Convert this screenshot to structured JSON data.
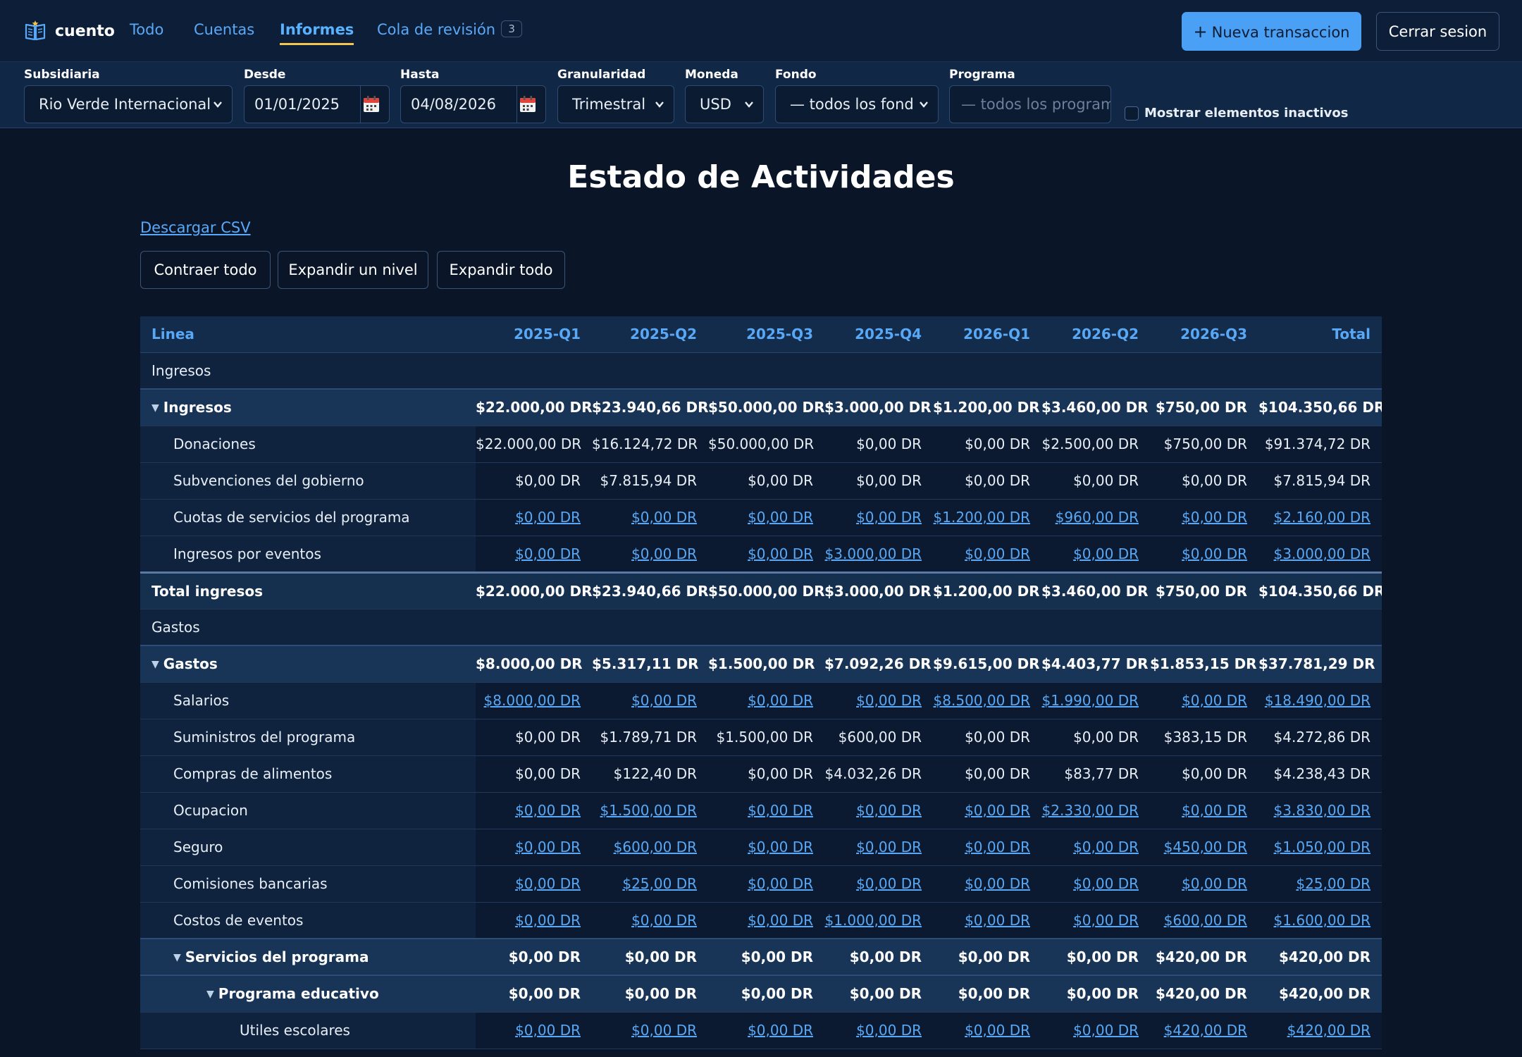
{
  "app": {
    "brand": "cuento",
    "nav": [
      {
        "label": "Todo"
      },
      {
        "label": "Cuentas"
      },
      {
        "label": "Informes",
        "active": true
      },
      {
        "label": "Cola de revisión",
        "badge": "3"
      }
    ],
    "new_tx_label": "Nueva transaccion",
    "logout_label": "Cerrar sesion",
    "accent": "#49a0f5",
    "link_color": "#58a8f6",
    "active_underline": "#f4c64f"
  },
  "filters": {
    "subsidiaria": {
      "label": "Subsidiaria",
      "value": "Rio Verde Internacional"
    },
    "desde": {
      "label": "Desde",
      "value": "01/01/2025"
    },
    "hasta": {
      "label": "Hasta",
      "value": "04/08/2026"
    },
    "granularidad": {
      "label": "Granularidad",
      "value": "Trimestral"
    },
    "moneda": {
      "label": "Moneda",
      "value": "USD"
    },
    "fondo": {
      "label": "Fondo",
      "value": "— todos los fond"
    },
    "programa": {
      "label": "Programa",
      "placeholder": "— todos los program"
    },
    "inactivos": {
      "label": "Mostrar elementos inactivos",
      "checked": false
    }
  },
  "report": {
    "title": "Estado de Actividades",
    "csv_label": "Descargar CSV",
    "collapse_all": "Contraer todo",
    "expand_one": "Expandir un nivel",
    "expand_all": "Expandir todo",
    "columns": [
      "Linea",
      "2025-Q1",
      "2025-Q2",
      "2025-Q3",
      "2025-Q4",
      "2026-Q1",
      "2026-Q2",
      "2026-Q3",
      "Total"
    ],
    "rows": [
      {
        "type": "section",
        "label": "Ingresos"
      },
      {
        "type": "group",
        "label": "Ingresos",
        "indent": 1,
        "values": [
          "$22.000,00 DR",
          "$23.940,66 DR",
          "$50.000,00 DR",
          "$3.000,00 DR",
          "$1.200,00 DR",
          "$3.460,00 DR",
          "$750,00 DR",
          "$104.350,66 DR"
        ]
      },
      {
        "type": "line",
        "label": "Donaciones",
        "indent": 2,
        "link": false,
        "values": [
          "$22.000,00 DR",
          "$16.124,72 DR",
          "$50.000,00 DR",
          "$0,00 DR",
          "$0,00 DR",
          "$2.500,00 DR",
          "$750,00 DR",
          "$91.374,72 DR"
        ]
      },
      {
        "type": "line",
        "label": "Subvenciones del gobierno",
        "indent": 2,
        "link": false,
        "values": [
          "$0,00 DR",
          "$7.815,94 DR",
          "$0,00 DR",
          "$0,00 DR",
          "$0,00 DR",
          "$0,00 DR",
          "$0,00 DR",
          "$7.815,94 DR"
        ]
      },
      {
        "type": "line",
        "label": "Cuotas de servicios del programa",
        "indent": 2,
        "link": true,
        "values": [
          "$0,00 DR",
          "$0,00 DR",
          "$0,00 DR",
          "$0,00 DR",
          "$1.200,00 DR",
          "$960,00 DR",
          "$0,00 DR",
          "$2.160,00 DR"
        ]
      },
      {
        "type": "line",
        "label": "Ingresos por eventos",
        "indent": 2,
        "link": true,
        "values": [
          "$0,00 DR",
          "$0,00 DR",
          "$0,00 DR",
          "$3.000,00 DR",
          "$0,00 DR",
          "$0,00 DR",
          "$0,00 DR",
          "$3.000,00 DR"
        ]
      },
      {
        "type": "total",
        "label": "Total ingresos",
        "values": [
          "$22.000,00 DR",
          "$23.940,66 DR",
          "$50.000,00 DR",
          "$3.000,00 DR",
          "$1.200,00 DR",
          "$3.460,00 DR",
          "$750,00 DR",
          "$104.350,66 DR"
        ]
      },
      {
        "type": "section",
        "label": "Gastos"
      },
      {
        "type": "group",
        "label": "Gastos",
        "indent": 1,
        "values": [
          "$8.000,00 DR",
          "$5.317,11 DR",
          "$1.500,00 DR",
          "$7.092,26 DR",
          "$9.615,00 DR",
          "$4.403,77 DR",
          "$1.853,15 DR",
          "$37.781,29 DR"
        ]
      },
      {
        "type": "line",
        "label": "Salarios",
        "indent": 2,
        "link": true,
        "values": [
          "$8.000,00 DR",
          "$0,00 DR",
          "$0,00 DR",
          "$0,00 DR",
          "$8.500,00 DR",
          "$1.990,00 DR",
          "$0,00 DR",
          "$18.490,00 DR"
        ]
      },
      {
        "type": "line",
        "label": "Suministros del programa",
        "indent": 2,
        "link": false,
        "values": [
          "$0,00 DR",
          "$1.789,71 DR",
          "$1.500,00 DR",
          "$600,00 DR",
          "$0,00 DR",
          "$0,00 DR",
          "$383,15 DR",
          "$4.272,86 DR"
        ]
      },
      {
        "type": "line",
        "label": "Compras de alimentos",
        "indent": 2,
        "link": false,
        "values": [
          "$0,00 DR",
          "$122,40 DR",
          "$0,00 DR",
          "$4.032,26 DR",
          "$0,00 DR",
          "$83,77 DR",
          "$0,00 DR",
          "$4.238,43 DR"
        ]
      },
      {
        "type": "line",
        "label": "Ocupacion",
        "indent": 2,
        "link": true,
        "values": [
          "$0,00 DR",
          "$1.500,00 DR",
          "$0,00 DR",
          "$0,00 DR",
          "$0,00 DR",
          "$2.330,00 DR",
          "$0,00 DR",
          "$3.830,00 DR"
        ]
      },
      {
        "type": "line",
        "label": "Seguro",
        "indent": 2,
        "link": true,
        "values": [
          "$0,00 DR",
          "$600,00 DR",
          "$0,00 DR",
          "$0,00 DR",
          "$0,00 DR",
          "$0,00 DR",
          "$450,00 DR",
          "$1.050,00 DR"
        ]
      },
      {
        "type": "line",
        "label": "Comisiones bancarias",
        "indent": 2,
        "link": true,
        "values": [
          "$0,00 DR",
          "$25,00 DR",
          "$0,00 DR",
          "$0,00 DR",
          "$0,00 DR",
          "$0,00 DR",
          "$0,00 DR",
          "$25,00 DR"
        ]
      },
      {
        "type": "line",
        "label": "Costos de eventos",
        "indent": 2,
        "link": true,
        "values": [
          "$0,00 DR",
          "$0,00 DR",
          "$0,00 DR",
          "$1.000,00 DR",
          "$0,00 DR",
          "$0,00 DR",
          "$600,00 DR",
          "$1.600,00 DR"
        ]
      },
      {
        "type": "group",
        "label": "Servicios del programa",
        "indent": 3,
        "values": [
          "$0,00 DR",
          "$0,00 DR",
          "$0,00 DR",
          "$0,00 DR",
          "$0,00 DR",
          "$0,00 DR",
          "$420,00 DR",
          "$420,00 DR"
        ]
      },
      {
        "type": "group",
        "label": "Programa educativo",
        "indent": 4,
        "values": [
          "$0,00 DR",
          "$0,00 DR",
          "$0,00 DR",
          "$0,00 DR",
          "$0,00 DR",
          "$0,00 DR",
          "$420,00 DR",
          "$420,00 DR"
        ]
      },
      {
        "type": "line",
        "label": "Utiles escolares",
        "indent": 5,
        "link": true,
        "values": [
          "$0,00 DR",
          "$0,00 DR",
          "$0,00 DR",
          "$0,00 DR",
          "$0,00 DR",
          "$0,00 DR",
          "$420,00 DR",
          "$420,00 DR"
        ]
      }
    ]
  }
}
